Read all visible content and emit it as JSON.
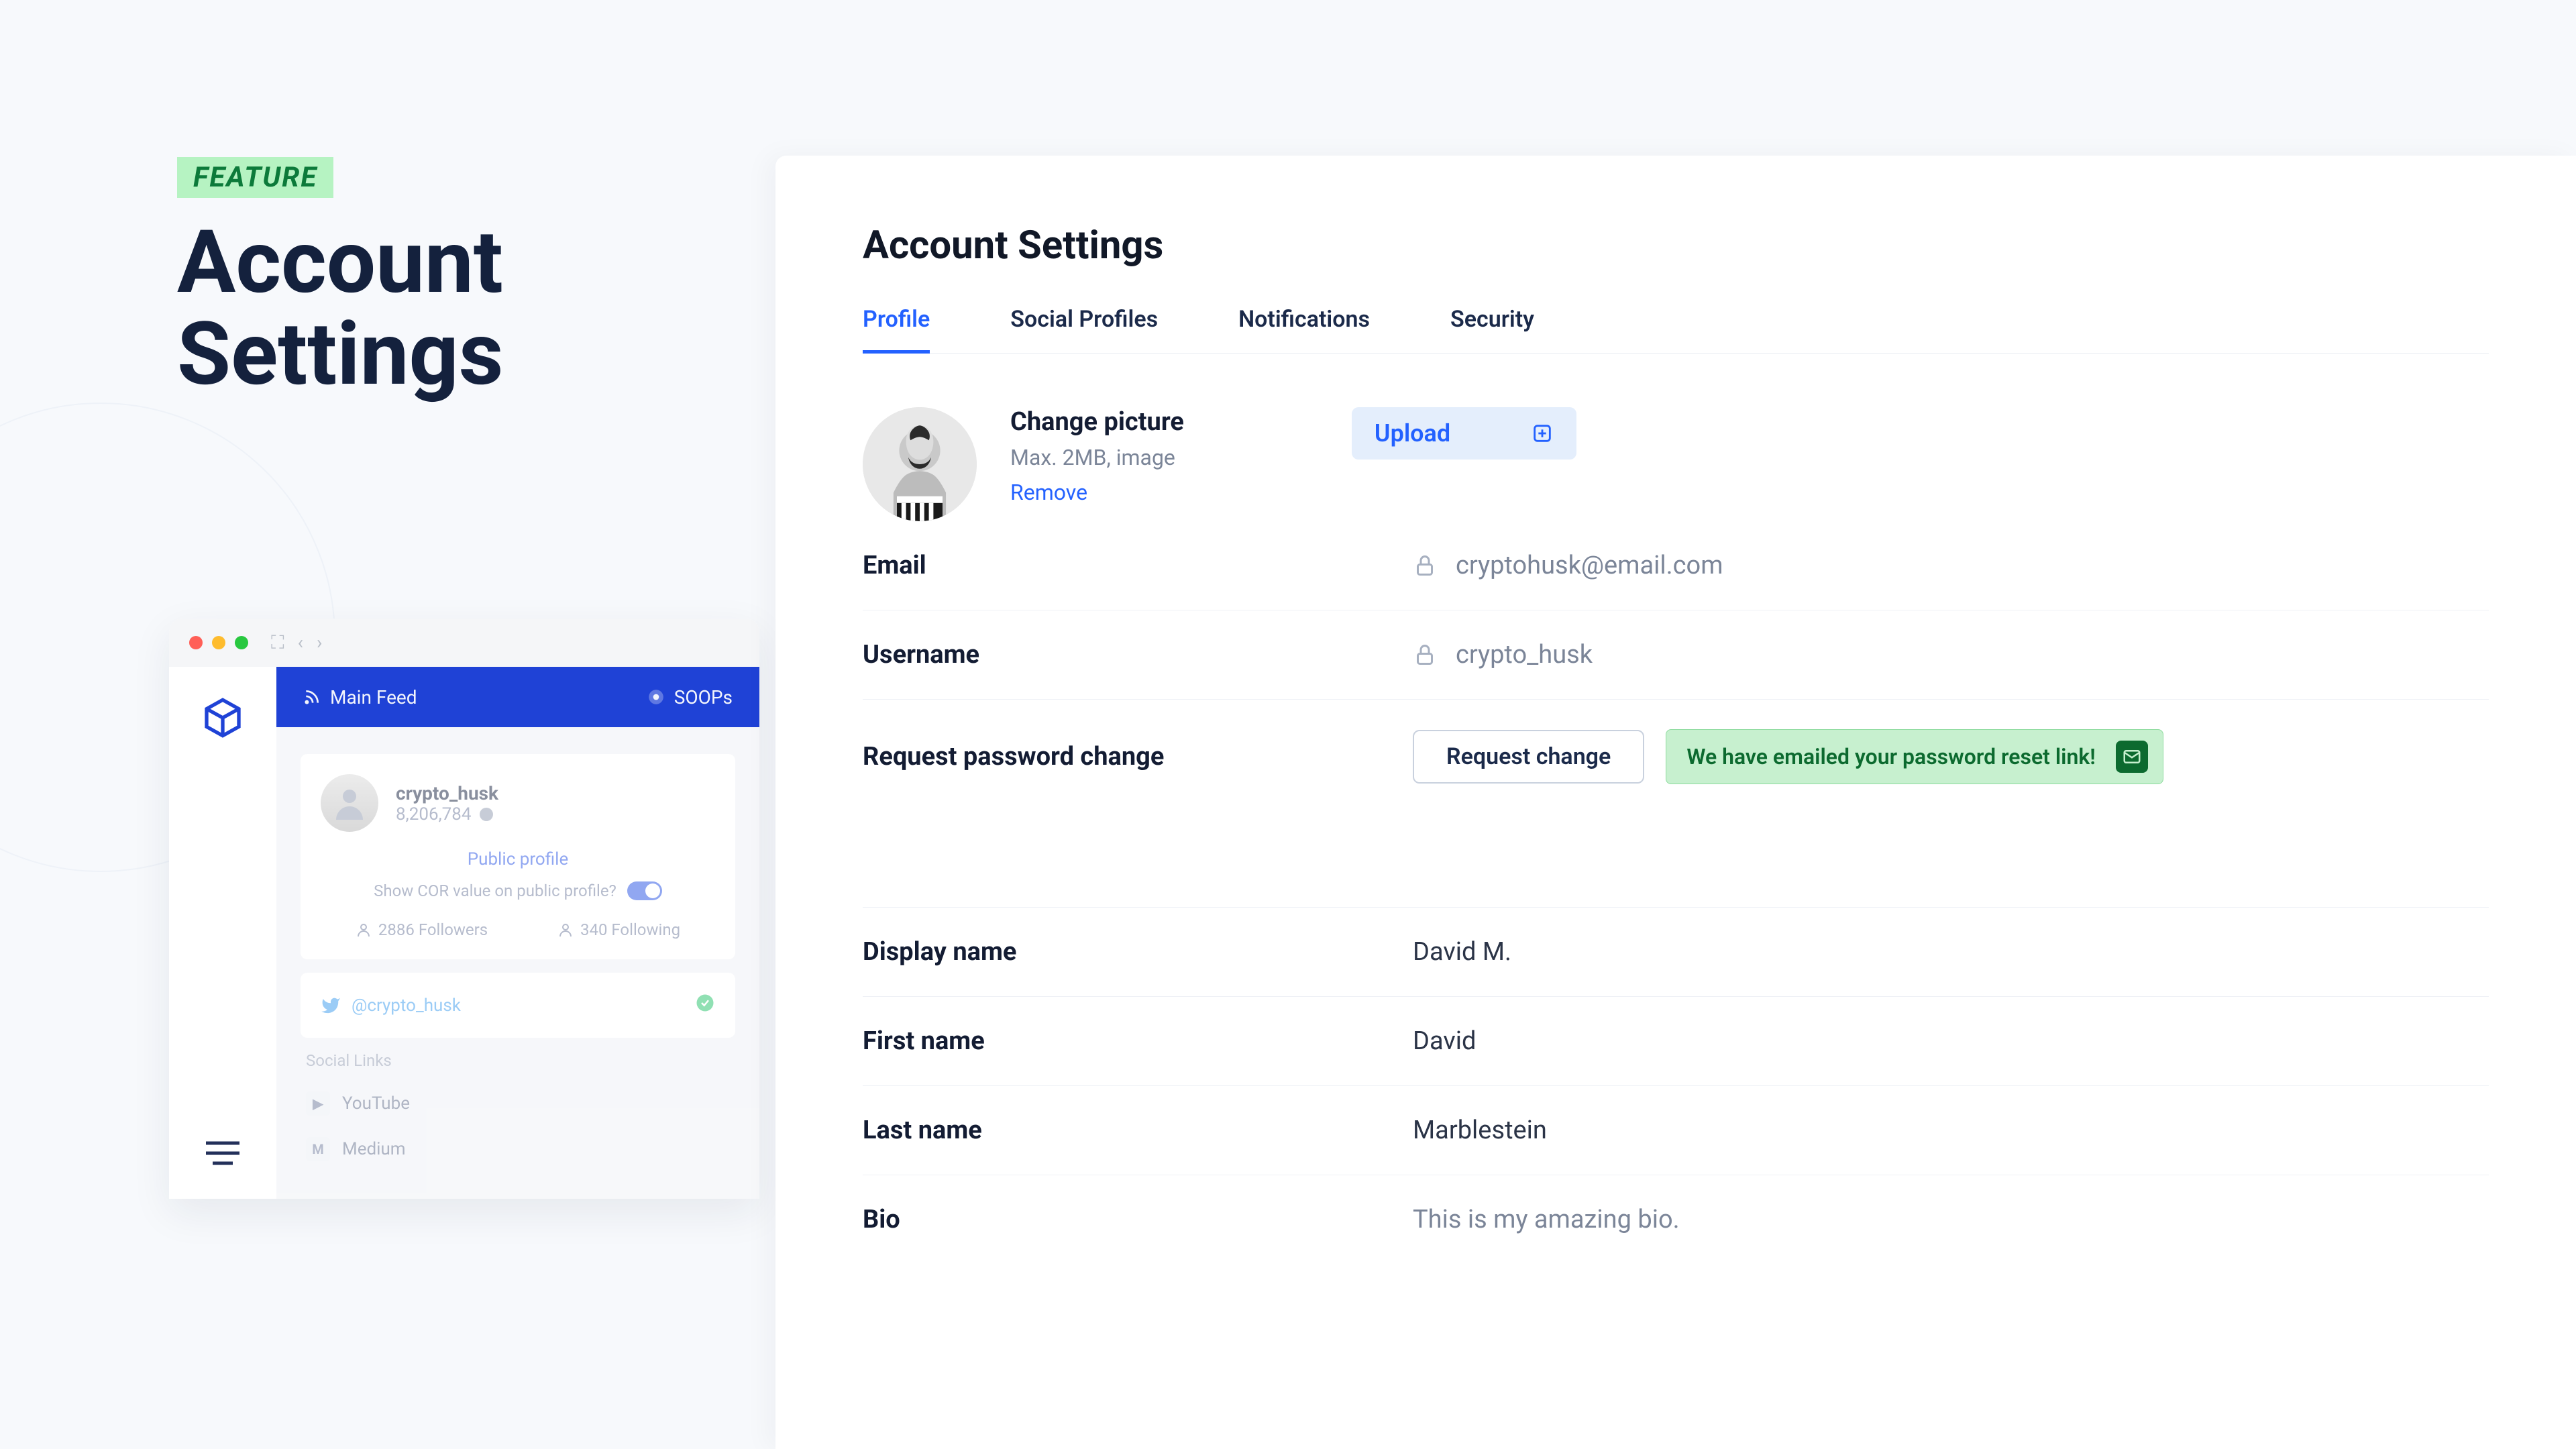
{
  "hero": {
    "badge": "FEATURE",
    "title_l1": "Account",
    "title_l2": "Settings"
  },
  "mini": {
    "top_feed": "Main Feed",
    "top_soops": "SOOPs",
    "username": "crypto_husk",
    "cor": "8,206,784",
    "public_profile": "Public profile",
    "show_cor": "Show COR value on public profile?",
    "followers": "2886 Followers",
    "following": "340 Following",
    "twitter_handle": "@crypto_husk",
    "social_header": "Social Links",
    "youtube": "YouTube",
    "medium": "Medium"
  },
  "panel": {
    "title": "Account Settings",
    "tabs": {
      "profile": "Profile",
      "social": "Social Profiles",
      "notifications": "Notifications",
      "security": "Security"
    },
    "picture": {
      "heading": "Change picture",
      "hint": "Max. 2MB, image",
      "remove": "Remove",
      "upload": "Upload"
    },
    "email": {
      "label": "Email",
      "value": "cryptohusk@email.com"
    },
    "username": {
      "label": "Username",
      "value": "crypto_husk"
    },
    "password": {
      "label": "Request password change",
      "button": "Request change",
      "banner": "We have emailed your password reset link!"
    },
    "display_name": {
      "label": "Display name",
      "value": "David M."
    },
    "first_name": {
      "label": "First name",
      "value": "David"
    },
    "last_name": {
      "label": "Last name",
      "value": "Marblestein"
    },
    "bio": {
      "label": "Bio",
      "value": "This is my amazing bio."
    }
  }
}
